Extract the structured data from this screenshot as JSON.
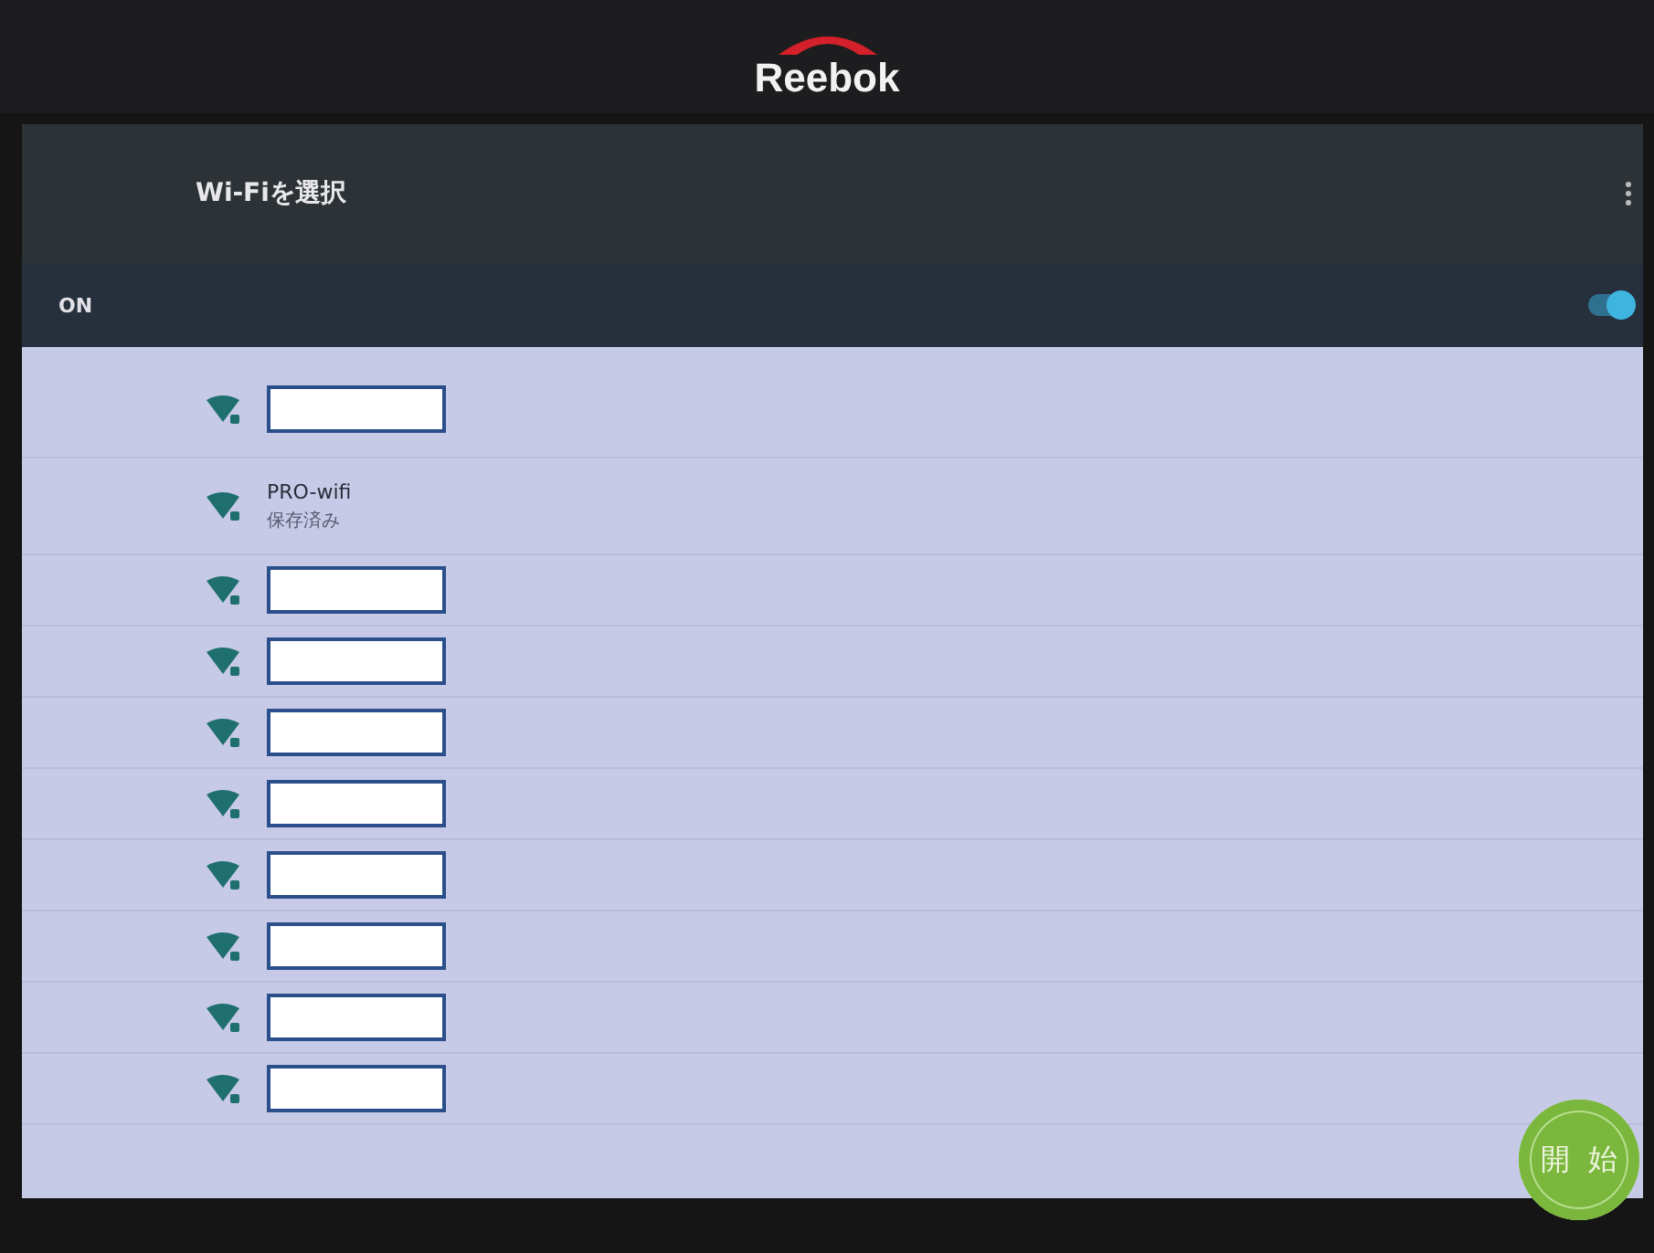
{
  "bezel": {
    "logo": "Reebok"
  },
  "header": {
    "title": "Wi-Fiを選択"
  },
  "wifi_switch": {
    "label": "ON",
    "on": true
  },
  "networks": [
    {
      "kind": "redacted"
    },
    {
      "kind": "named",
      "name": "PRO-wifi",
      "status": "保存済み"
    },
    {
      "kind": "redacted"
    },
    {
      "kind": "redacted"
    },
    {
      "kind": "redacted"
    },
    {
      "kind": "redacted"
    },
    {
      "kind": "redacted"
    },
    {
      "kind": "redacted"
    },
    {
      "kind": "redacted"
    },
    {
      "kind": "redacted"
    }
  ],
  "start_button": {
    "label": "開始"
  }
}
